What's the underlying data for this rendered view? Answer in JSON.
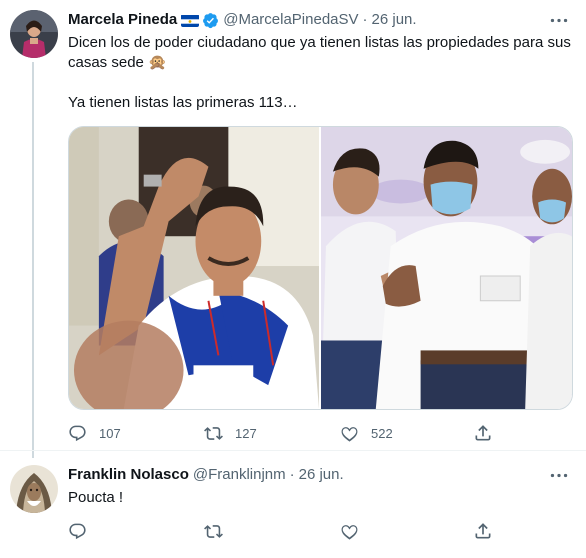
{
  "colors": {
    "text": "#0f1419",
    "muted": "#536471",
    "verified": "#1d9bf0",
    "border": "#cfd9de"
  },
  "tweets": [
    {
      "name": "Marcela Pineda",
      "flag": "el-salvador-flag",
      "verified": true,
      "handle": "@MarcelaPinedaSV",
      "separator": "·",
      "date": "26 jun.",
      "text_lines": [
        "Dicen los de poder ciudadano que ya tienen listas las propiedades para sus",
        "casas sede 🙊",
        "",
        "Ya tienen listas las primeras 113…"
      ],
      "media": [
        "photo-left",
        "photo-right"
      ],
      "replies": "107",
      "retweets": "127",
      "likes": "522"
    },
    {
      "name": "Franklin Nolasco",
      "handle": "@Franklinjnm",
      "separator": "·",
      "date": "26 jun.",
      "text_lines": [
        "Poucta !"
      ],
      "replies": "",
      "retweets": "",
      "likes": ""
    }
  ],
  "icons": {
    "reply": "reply-icon",
    "retweet": "retweet-icon",
    "like": "heart-icon",
    "share": "share-icon",
    "more": "more-icon",
    "verified": "verified-badge-icon"
  }
}
